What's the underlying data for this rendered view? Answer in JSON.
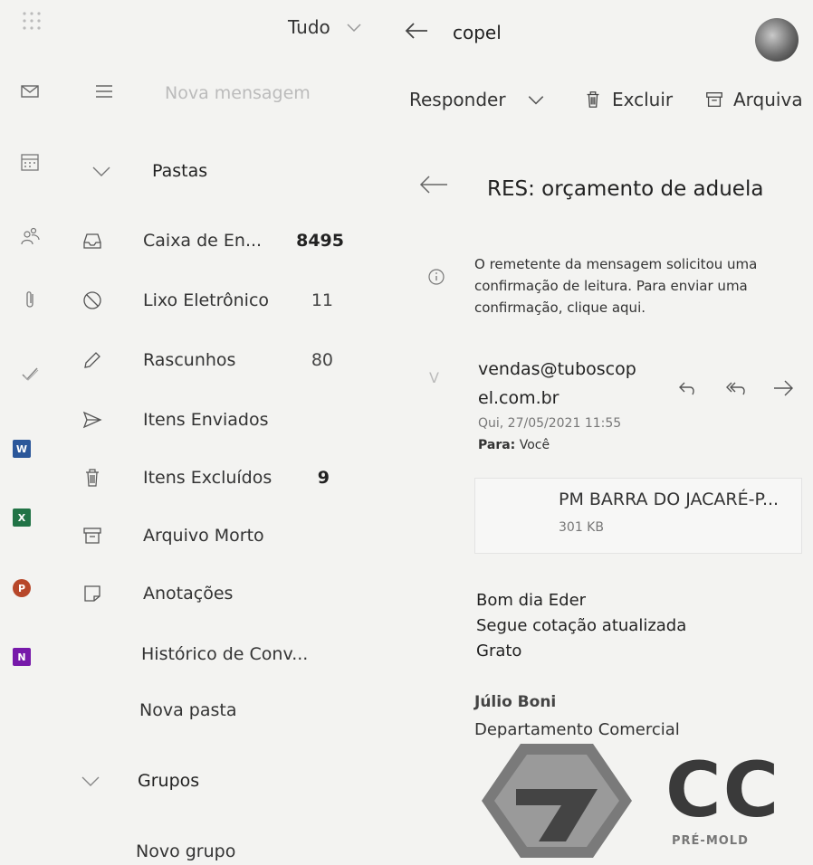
{
  "topbar": {
    "filter_label": "Tudo",
    "search_value": "copel"
  },
  "compose": {
    "new_message_label": "Nova mensagem"
  },
  "folders": {
    "header": "Pastas",
    "items": [
      {
        "label": "Caixa de En...",
        "count": "8495",
        "icon": "inbox-icon"
      },
      {
        "label": "Lixo Eletrônico",
        "count": "11",
        "icon": "junk-icon"
      },
      {
        "label": "Rascunhos",
        "count": "80",
        "icon": "pencil-icon"
      },
      {
        "label": "Itens Enviados",
        "count": "",
        "icon": "send-icon"
      },
      {
        "label": "Itens Excluídos",
        "count": "9",
        "icon": "trash-icon"
      },
      {
        "label": "Arquivo Morto",
        "count": "",
        "icon": "archive-icon"
      },
      {
        "label": "Anotações",
        "count": "",
        "icon": "note-icon"
      },
      {
        "label": "Histórico de Conv...",
        "count": "",
        "icon": ""
      },
      {
        "label": "Nova pasta",
        "count": "",
        "icon": ""
      }
    ],
    "groups_header": "Grupos",
    "new_group": "Novo grupo"
  },
  "toolbar": {
    "reply_label": "Responder",
    "delete_label": "Excluir",
    "archive_label": "Arquiva"
  },
  "message": {
    "subject": "RES: orçamento de aduela",
    "read_receipt": [
      "O remetente da mensagem solicitou uma",
      "confirmação de leitura. Para enviar uma",
      "confirmação, clique aqui."
    ],
    "sender_initial": "V",
    "sender_line1": "vendas@tuboscop",
    "sender_line2": "el.com.br",
    "date": "Qui, 27/05/2021 11:55",
    "to_label": "Para:",
    "to_value": "Você",
    "attachment_name": "PM BARRA DO JACARÉ-P...",
    "attachment_size": "301 KB",
    "body": [
      "Bom dia Eder",
      "Segue cotação atualizada",
      "Grato"
    ],
    "signature_name": "Júlio Boni",
    "signature_dept": "Departamento Comercial",
    "logo_text": "CC",
    "logo_sub": "PRÉ-MOLD"
  },
  "colors": {
    "word": "#2b579a",
    "excel": "#217346",
    "powerpoint": "#b7472a",
    "onenote": "#7719aa"
  }
}
